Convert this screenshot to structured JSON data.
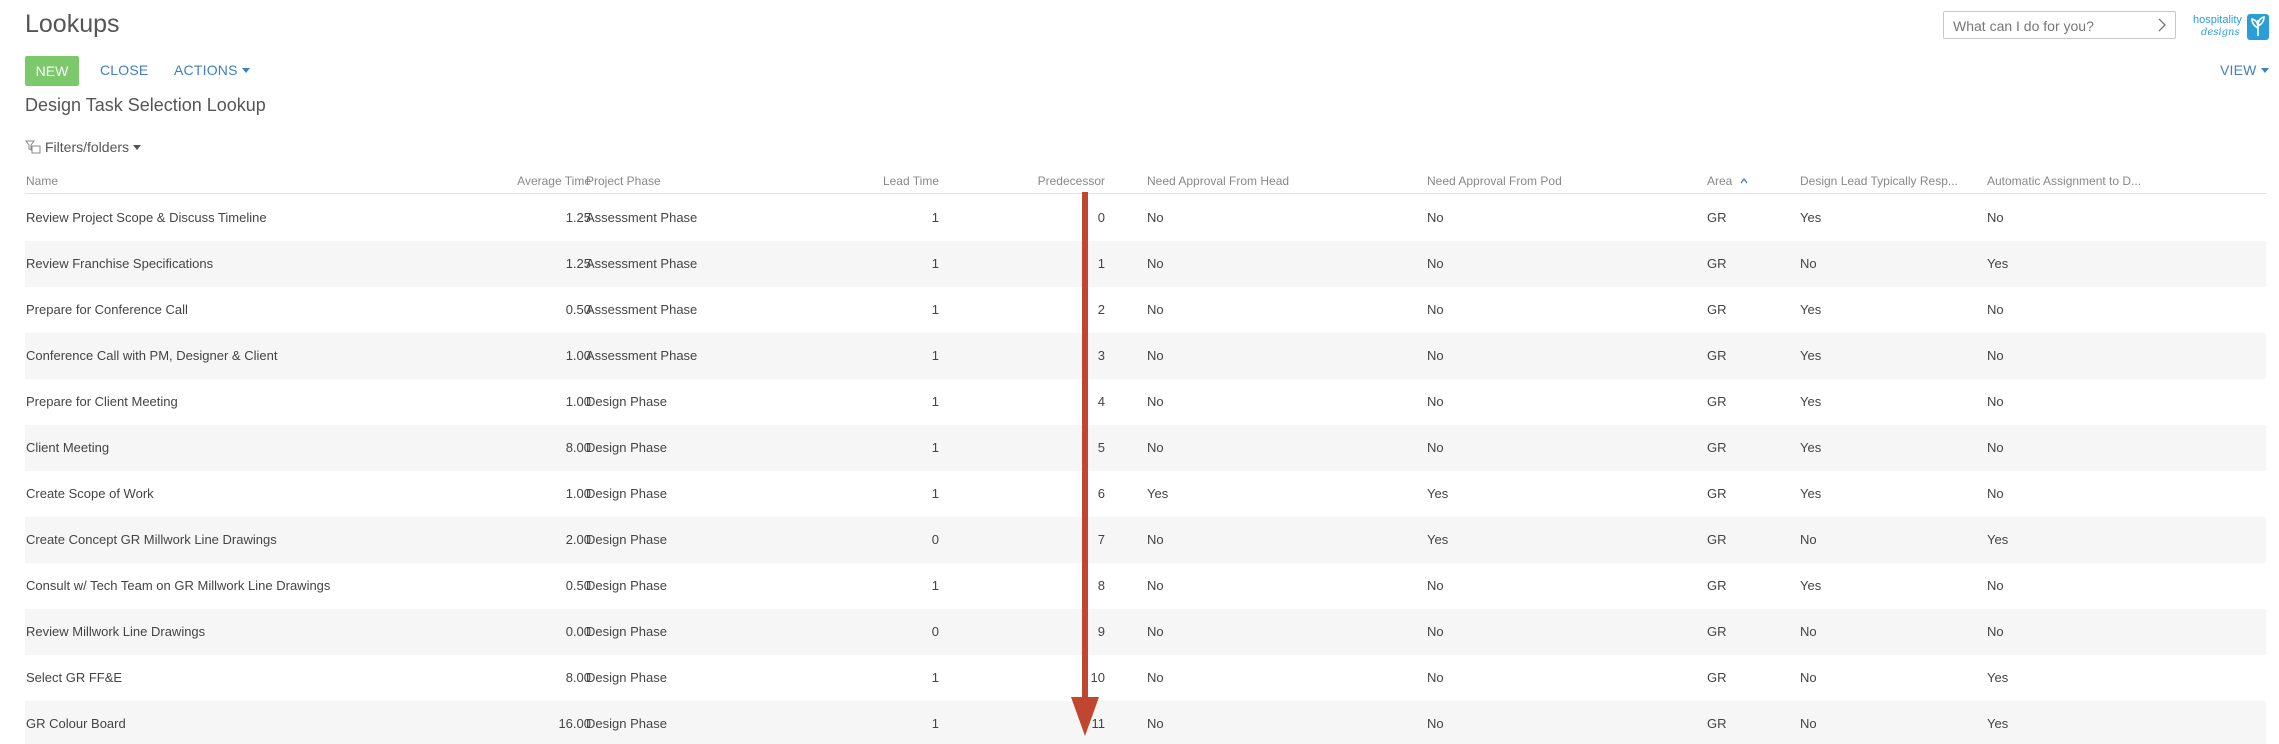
{
  "header": {
    "title": "Lookups",
    "search_placeholder": "What can I do for you?",
    "logo_line1": "hospitality",
    "logo_line2": "designs"
  },
  "toolbar": {
    "new_label": "NEW",
    "close_label": "CLOSE",
    "actions_label": "ACTIONS",
    "view_label": "VIEW"
  },
  "section": {
    "title": "Design Task Selection Lookup",
    "filters_label": "Filters/folders"
  },
  "colors": {
    "new_button": "#7bc96a",
    "link": "#3f7fbf",
    "annotation_arrow": "#c0462f",
    "row_alt": "#f6f6f6"
  },
  "grid": {
    "columns": [
      "Name",
      "Average Time",
      "Project Phase",
      "Lead Time",
      "Predecessor",
      "Need Approval From Head",
      "Need Approval From Pod",
      "Area",
      "Design Lead Typically Resp...",
      "Automatic Assignment to D..."
    ],
    "sorted_column": "Area",
    "sort_direction": "ascending",
    "rows": [
      [
        "Review Project Scope & Discuss Timeline",
        "1.25",
        "Assessment Phase",
        "1",
        "0",
        "No",
        "No",
        "GR",
        "Yes",
        "No"
      ],
      [
        "Review Franchise Specifications",
        "1.25",
        "Assessment Phase",
        "1",
        "1",
        "No",
        "No",
        "GR",
        "No",
        "Yes"
      ],
      [
        "Prepare for Conference Call",
        "0.50",
        "Assessment Phase",
        "1",
        "2",
        "No",
        "No",
        "GR",
        "Yes",
        "No"
      ],
      [
        "Conference Call with PM, Designer & Client",
        "1.00",
        "Assessment Phase",
        "1",
        "3",
        "No",
        "No",
        "GR",
        "Yes",
        "No"
      ],
      [
        "Prepare for Client Meeting",
        "1.00",
        "Design Phase",
        "1",
        "4",
        "No",
        "No",
        "GR",
        "Yes",
        "No"
      ],
      [
        "Client Meeting",
        "8.00",
        "Design Phase",
        "1",
        "5",
        "No",
        "No",
        "GR",
        "Yes",
        "No"
      ],
      [
        "Create Scope of Work",
        "1.00",
        "Design Phase",
        "1",
        "6",
        "Yes",
        "Yes",
        "GR",
        "Yes",
        "No"
      ],
      [
        "Create Concept GR Millwork Line Drawings",
        "2.00",
        "Design Phase",
        "0",
        "7",
        "No",
        "Yes",
        "GR",
        "No",
        "Yes"
      ],
      [
        "Consult w/ Tech Team on GR Millwork Line Drawings",
        "0.50",
        "Design Phase",
        "1",
        "8",
        "No",
        "No",
        "GR",
        "Yes",
        "No"
      ],
      [
        "Review Millwork Line Drawings",
        "0.00",
        "Design Phase",
        "0",
        "9",
        "No",
        "No",
        "GR",
        "No",
        "No"
      ],
      [
        "Select GR FF&E",
        "8.00",
        "Design Phase",
        "1",
        "10",
        "No",
        "No",
        "GR",
        "No",
        "Yes"
      ],
      [
        "GR Colour Board",
        "16.00",
        "Design Phase",
        "1",
        "11",
        "No",
        "No",
        "GR",
        "No",
        "Yes"
      ]
    ]
  }
}
